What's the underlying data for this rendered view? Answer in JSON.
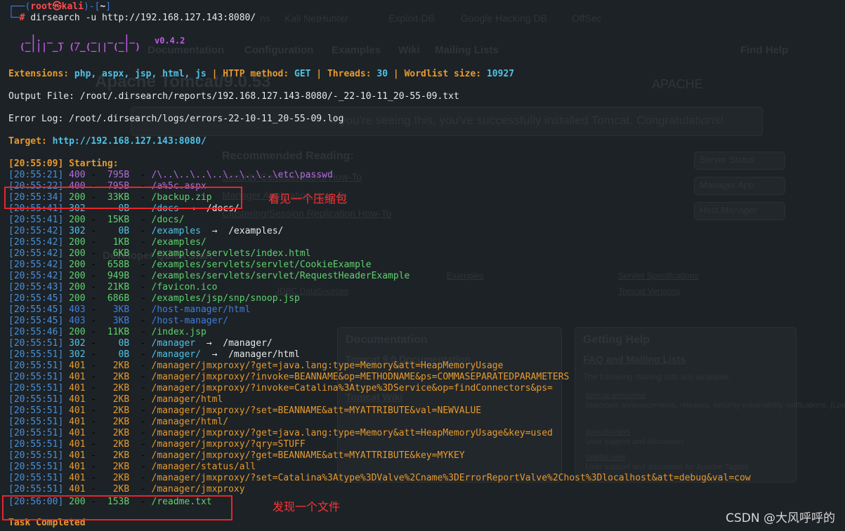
{
  "prompt": {
    "user_host": "root㉿kali",
    "cwd": "~",
    "command": "dirsearch -u http://192.168.127.143:8080/"
  },
  "banner": {
    "version": "v0.4.2"
  },
  "config": {
    "extensions_label": "Extensions:",
    "extensions": "php, aspx, jsp, html, js",
    "method_label": "HTTP method:",
    "method": "GET",
    "threads_label": "Threads:",
    "threads": "30",
    "wordlist_label": "Wordlist size:",
    "wordlist": "10927",
    "sep": " | "
  },
  "output_file": "Output File: /root/.dirsearch/reports/192.168.127.143-8080/-_22-10-11_20-55-09.txt",
  "error_log": "Error Log: /root/.dirsearch/logs/errors-22-10-11_20-55-09.log",
  "target": {
    "label": "Target:",
    "url": "http://192.168.127.143:8080/"
  },
  "starting": "[20:55:09] Starting:",
  "results": [
    {
      "ts": "[20:55:21]",
      "code": "400",
      "size": "795B",
      "path": "/\\..\\..\\..\\..\\..\\..\\..\\etc\\passwd",
      "redirect": "",
      "color": "purple"
    },
    {
      "ts": "[20:55:22]",
      "code": "400",
      "size": "795B",
      "path": "/a%5c.aspx",
      "redirect": "",
      "color": "purple"
    },
    {
      "ts": "[20:55:34]",
      "code": "200",
      "size": "33KB",
      "path": "/backup.zip",
      "redirect": "",
      "color": "green"
    },
    {
      "ts": "[20:55:41]",
      "code": "302",
      "size": "0B",
      "path": "/docs",
      "redirect": "/docs/",
      "color": "cyan"
    },
    {
      "ts": "[20:55:41]",
      "code": "200",
      "size": "15KB",
      "path": "/docs/",
      "redirect": "",
      "color": "green"
    },
    {
      "ts": "[20:55:42]",
      "code": "302",
      "size": "0B",
      "path": "/examples",
      "redirect": "/examples/",
      "color": "cyan"
    },
    {
      "ts": "[20:55:42]",
      "code": "200",
      "size": "1KB",
      "path": "/examples/",
      "redirect": "",
      "color": "green"
    },
    {
      "ts": "[20:55:42]",
      "code": "200",
      "size": "6KB",
      "path": "/examples/servlets/index.html",
      "redirect": "",
      "color": "green"
    },
    {
      "ts": "[20:55:42]",
      "code": "200",
      "size": "658B",
      "path": "/examples/servlets/servlet/CookieExample",
      "redirect": "",
      "color": "green"
    },
    {
      "ts": "[20:55:42]",
      "code": "200",
      "size": "949B",
      "path": "/examples/servlets/servlet/RequestHeaderExample",
      "redirect": "",
      "color": "green"
    },
    {
      "ts": "[20:55:43]",
      "code": "200",
      "size": "21KB",
      "path": "/favicon.ico",
      "redirect": "",
      "color": "green"
    },
    {
      "ts": "[20:55:45]",
      "code": "200",
      "size": "686B",
      "path": "/examples/jsp/snp/snoop.jsp",
      "redirect": "",
      "color": "green"
    },
    {
      "ts": "[20:55:45]",
      "code": "403",
      "size": "3KB",
      "path": "/host-manager/html",
      "redirect": "",
      "color": "blue"
    },
    {
      "ts": "[20:55:45]",
      "code": "403",
      "size": "3KB",
      "path": "/host-manager/",
      "redirect": "",
      "color": "blue"
    },
    {
      "ts": "[20:55:46]",
      "code": "200",
      "size": "11KB",
      "path": "/index.jsp",
      "redirect": "",
      "color": "green"
    },
    {
      "ts": "[20:55:51]",
      "code": "302",
      "size": "0B",
      "path": "/manager",
      "redirect": "/manager/",
      "color": "cyan"
    },
    {
      "ts": "[20:55:51]",
      "code": "302",
      "size": "0B",
      "path": "/manager/",
      "redirect": "/manager/html",
      "color": "cyan"
    },
    {
      "ts": "[20:55:51]",
      "code": "401",
      "size": "2KB",
      "path": "/manager/jmxproxy/?get=java.lang:type=Memory&att=HeapMemoryUsage",
      "redirect": "",
      "color": "orange"
    },
    {
      "ts": "[20:55:51]",
      "code": "401",
      "size": "2KB",
      "path": "/manager/jmxproxy/?invoke=BEANNAME&op=METHODNAME&ps=COMMASEPARATEDPARAMETERS",
      "redirect": "",
      "color": "orange"
    },
    {
      "ts": "[20:55:51]",
      "code": "401",
      "size": "2KB",
      "path": "/manager/jmxproxy/?invoke=Catalina%3Atype%3DService&op=findConnectors&ps=",
      "redirect": "",
      "color": "orange"
    },
    {
      "ts": "[20:55:51]",
      "code": "401",
      "size": "2KB",
      "path": "/manager/html",
      "redirect": "",
      "color": "orange"
    },
    {
      "ts": "[20:55:51]",
      "code": "401",
      "size": "2KB",
      "path": "/manager/jmxproxy/?set=BEANNAME&att=MYATTRIBUTE&val=NEWVALUE",
      "redirect": "",
      "color": "orange"
    },
    {
      "ts": "[20:55:51]",
      "code": "401",
      "size": "2KB",
      "path": "/manager/html/",
      "redirect": "",
      "color": "orange"
    },
    {
      "ts": "[20:55:51]",
      "code": "401",
      "size": "2KB",
      "path": "/manager/jmxproxy/?get=java.lang:type=Memory&att=HeapMemoryUsage&key=used",
      "redirect": "",
      "color": "orange"
    },
    {
      "ts": "[20:55:51]",
      "code": "401",
      "size": "2KB",
      "path": "/manager/jmxproxy/?qry=STUFF",
      "redirect": "",
      "color": "orange"
    },
    {
      "ts": "[20:55:51]",
      "code": "401",
      "size": "2KB",
      "path": "/manager/jmxproxy/?get=BEANNAME&att=MYATTRIBUTE&key=MYKEY",
      "redirect": "",
      "color": "orange"
    },
    {
      "ts": "[20:55:51]",
      "code": "401",
      "size": "2KB",
      "path": "/manager/status/all",
      "redirect": "",
      "color": "orange"
    },
    {
      "ts": "[20:55:51]",
      "code": "401",
      "size": "2KB",
      "path": "/manager/jmxproxy/?set=Catalina%3Atype%3DValve%2Cname%3DErrorReportValve%2Chost%3Dlocalhost&att=debug&val=cow",
      "redirect": "",
      "color": "orange"
    },
    {
      "ts": "[20:55:51]",
      "code": "401",
      "size": "2KB",
      "path": "/manager/jmxproxy",
      "redirect": "",
      "color": "orange"
    },
    {
      "ts": "[20:56:00]",
      "code": "200",
      "size": "153B",
      "path": "/readme.txt",
      "redirect": "",
      "color": "green"
    }
  ],
  "completed": "Task Completed",
  "notes": {
    "zip": "看见一个压缩包",
    "file": "发现一个文件"
  },
  "watermark": "CSDN @大风呼呼的",
  "ghost": {
    "tabs": [
      "ns",
      "Kali NetHunter",
      "Exploit-DB",
      "Google Hacking DB",
      "OffSec"
    ],
    "nav": [
      "Documentation",
      "Configuration",
      "Examples",
      "Wiki",
      "Mailing Lists"
    ],
    "find_help": "Find Help",
    "title": "Apache Tomcat/9.0.53",
    "apache": "APACHE",
    "banner_msg": "If you're seeing this, you've successfully installed Tomcat. Congratulations!",
    "recommended": "Recommended Reading:",
    "links": [
      "Security Considerations How-To",
      "Manager Application How-To",
      "Clustering/Session Replication How-To"
    ],
    "buttons": [
      "Server Status",
      "Manager App",
      "Host Manager"
    ],
    "dev_quick": "Developer Quick Start",
    "dev_links": [
      "Examples",
      "Servlet Specifications",
      "JDBC DataSources",
      "Tomcat Versions"
    ],
    "documentation": "Documentation",
    "tomcat_doc": "Tomcat 9.0 Documentation",
    "tomcat_wiki": "Tomcat Wiki",
    "getting_help": "Getting Help",
    "faq": "FAQ and Mailing Lists",
    "mailing_text": "The following mailing lists are available:",
    "list_items": [
      "tomcat-announce",
      "Important announcements, releases, security vulnerability notifications. (Low volume).",
      "tomcat-users",
      "User support and discussion",
      "taglibs-user",
      "User support and discussion for Apache Taglibs"
    ]
  },
  "colors": {
    "green": "#5ed26e",
    "cyan": "#4fc3e6",
    "blue": "#3d7fe0",
    "orange": "#e69a2e",
    "purple": "#b46be0",
    "ts": "#4b8fd6",
    "note": "#ff3333"
  }
}
